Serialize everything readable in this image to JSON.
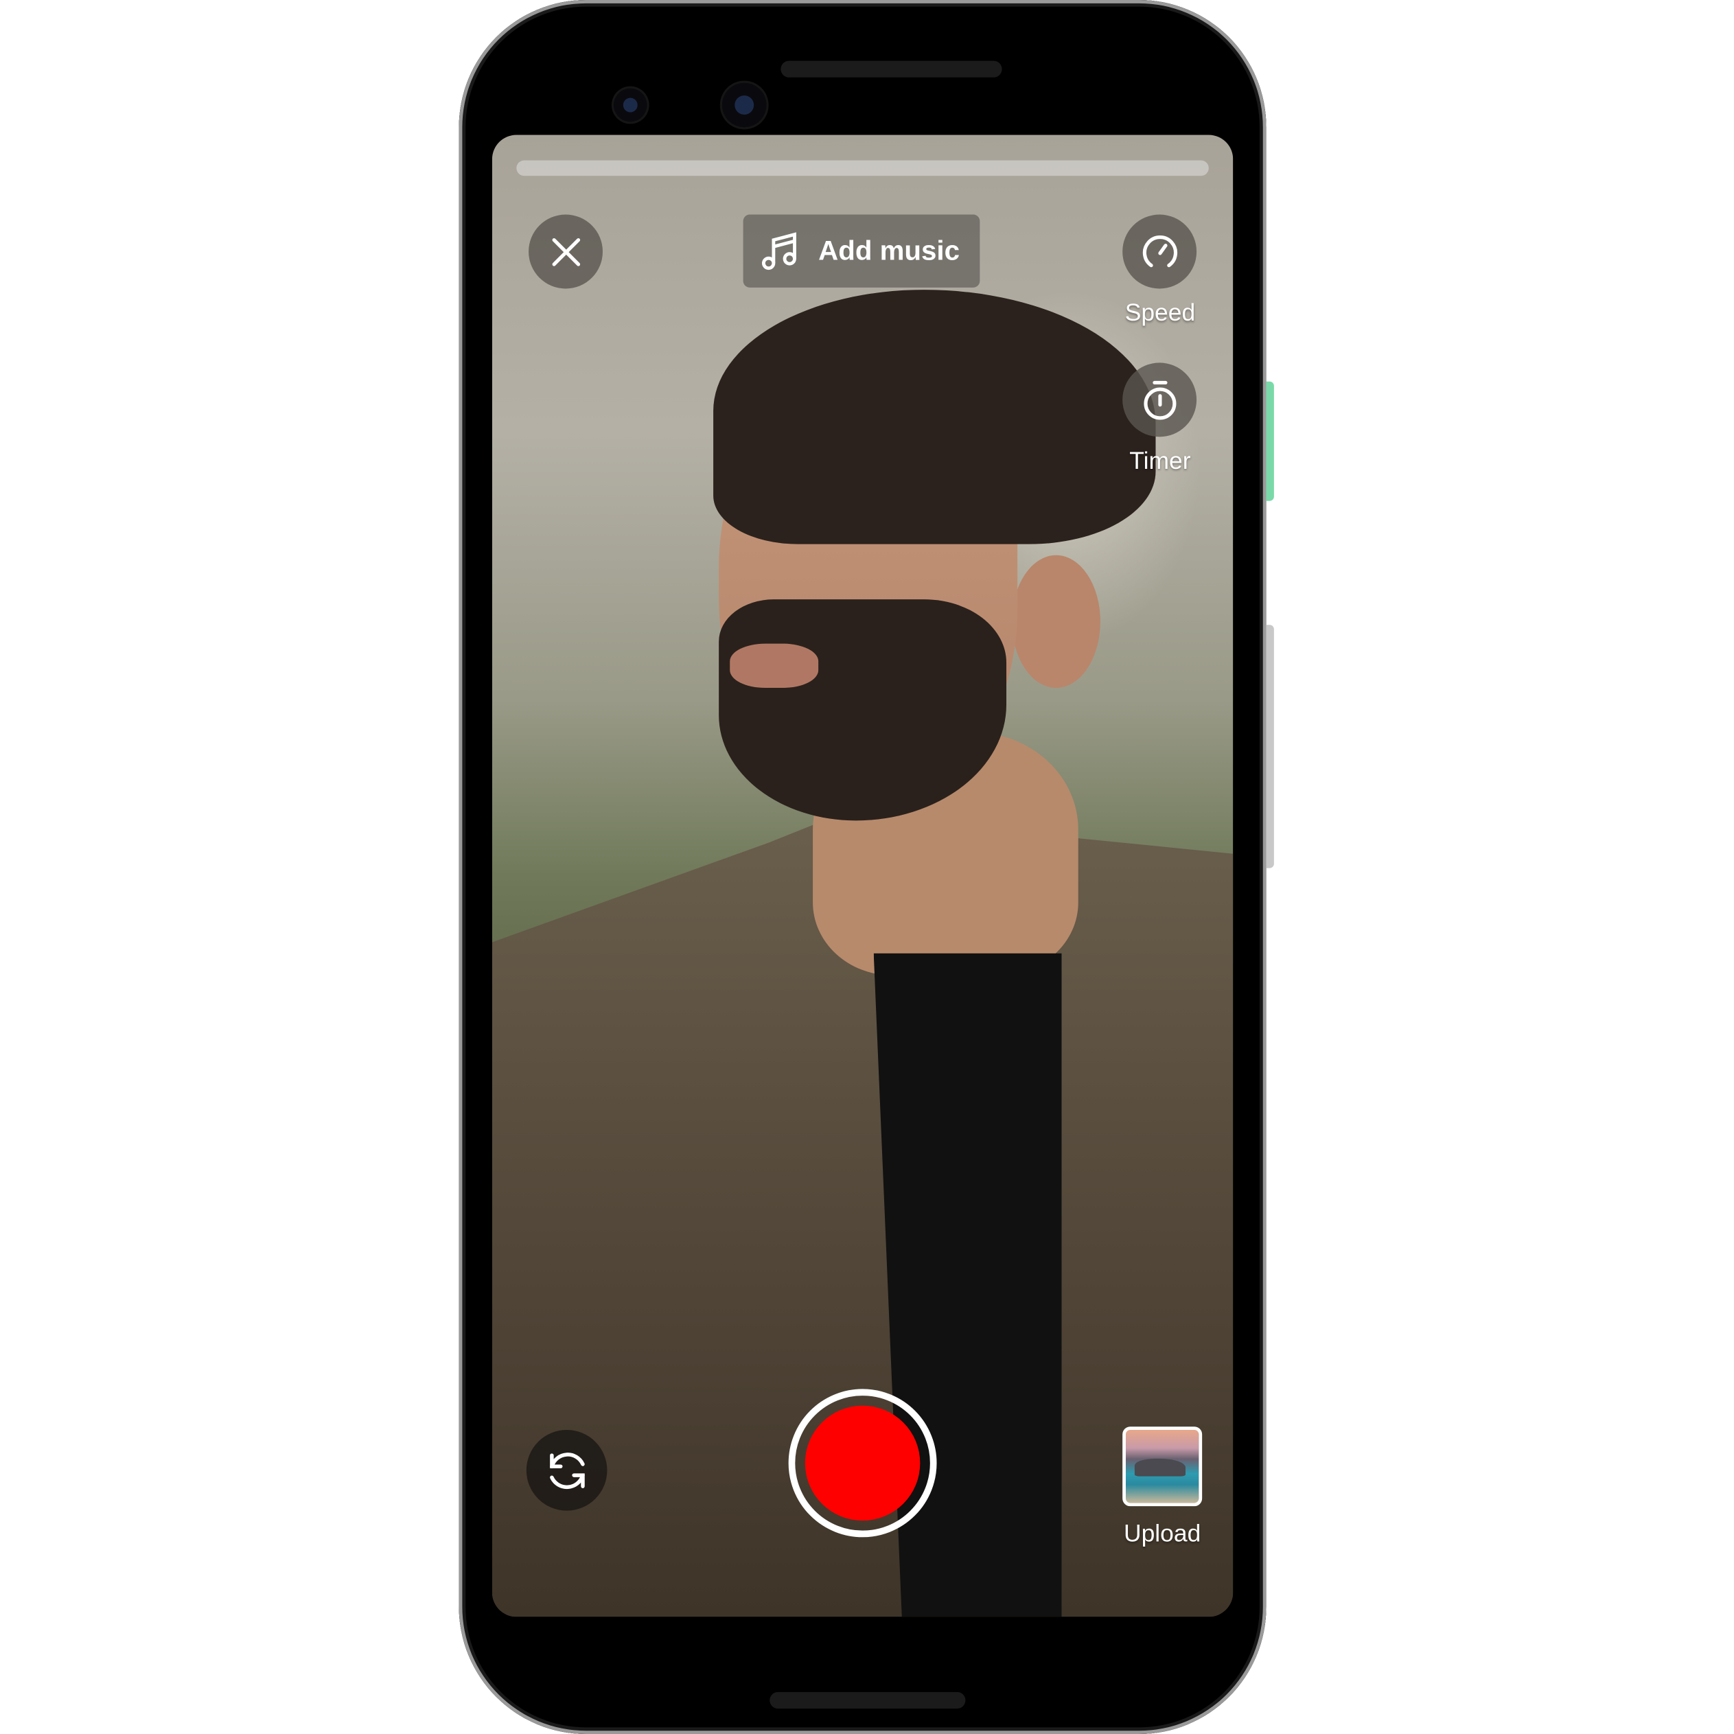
{
  "toolbar": {
    "close_icon": "close-icon",
    "add_music_label": "Add music",
    "music_icon": "music-note-icon"
  },
  "side_controls": {
    "speed_label": "Speed",
    "speed_icon": "speedometer-icon",
    "timer_label": "Timer",
    "timer_icon": "stopwatch-icon"
  },
  "bottom_controls": {
    "flip_icon": "flip-camera-icon",
    "record_color": "#ff0000",
    "upload_label": "Upload"
  },
  "recording_progress": 0
}
